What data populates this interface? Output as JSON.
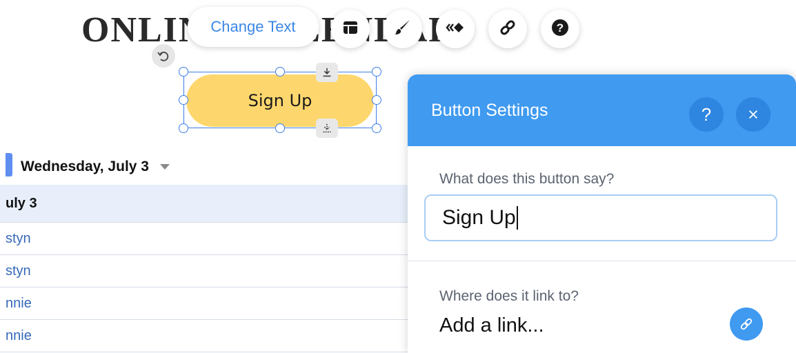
{
  "site": {
    "title": "ONLINE CALENDAR"
  },
  "toolbar": {
    "change_text_label": "Change Text",
    "icons": [
      "layout-icon",
      "design-brush-icon",
      "animation-icon",
      "link-icon",
      "help-icon"
    ]
  },
  "canvas_button": {
    "label": "Sign Up",
    "color": "#fdd76d"
  },
  "calendar": {
    "date_header": "Wednesday, July 3",
    "list_header": "uly 3",
    "rows": [
      "styn",
      "styn",
      "nnie",
      "nnie"
    ],
    "accent": "#5f8ef0"
  },
  "panel": {
    "title": "Button Settings",
    "text_label": "What does this button say?",
    "text_value": "Sign Up",
    "link_label": "Where does it link to?",
    "link_value": "Add a link...",
    "accent": "#3f9af0"
  }
}
